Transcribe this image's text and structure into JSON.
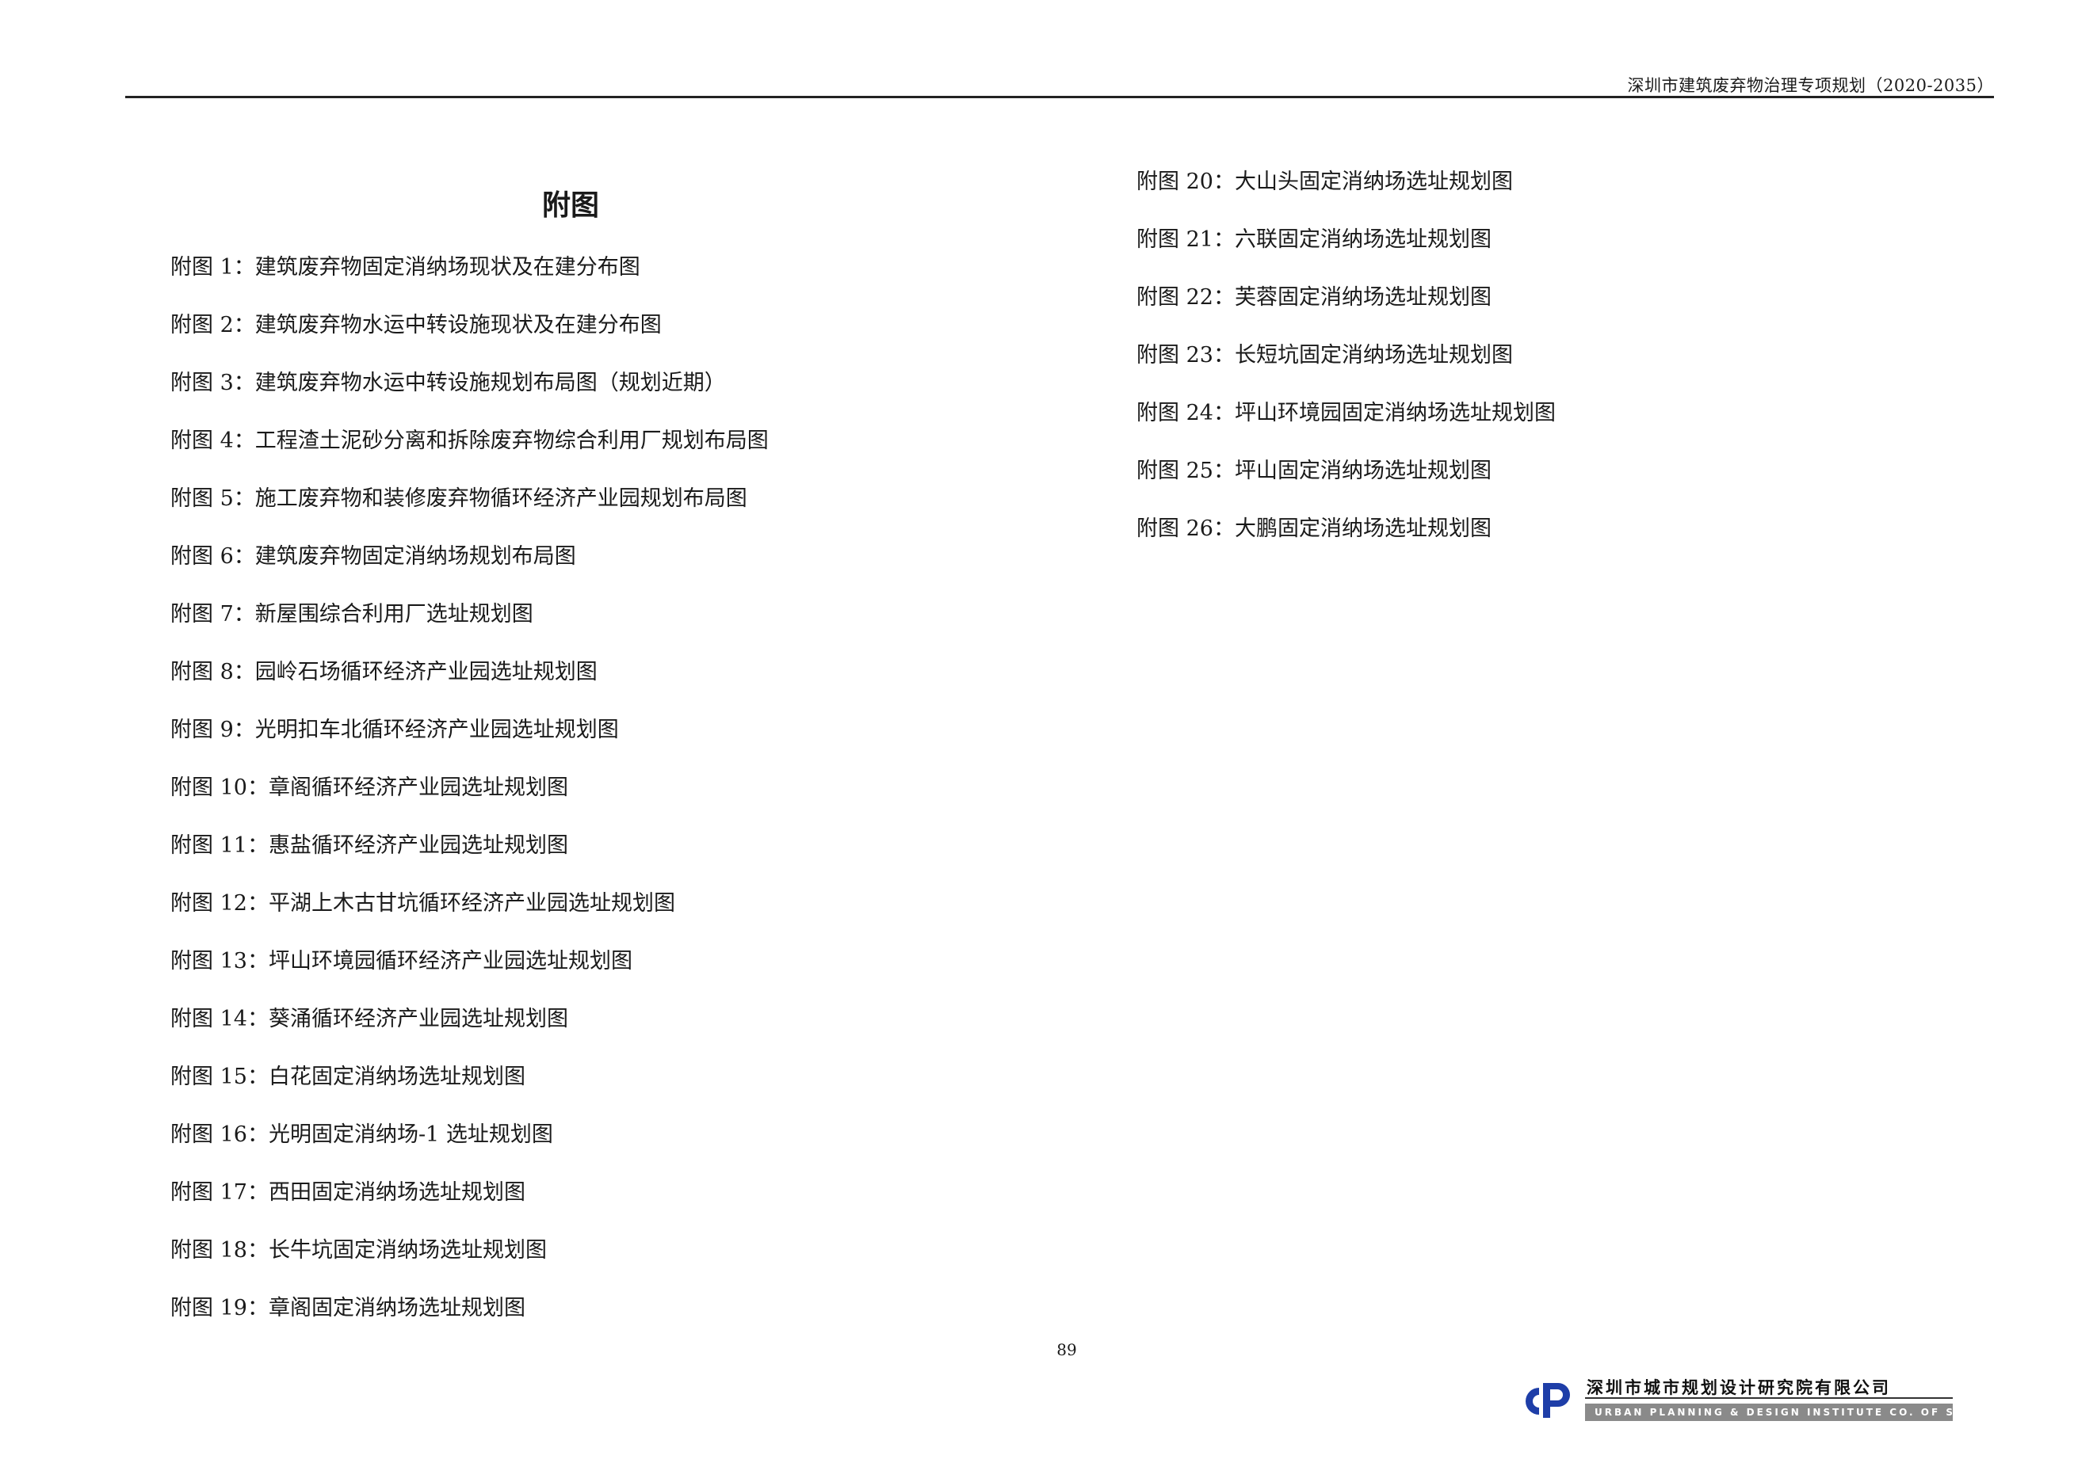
{
  "header": {
    "title": "深圳市建筑废弃物治理专项规划（2020-2035）"
  },
  "page_title": "附图",
  "left_items": [
    "附图 1：建筑废弃物固定消纳场现状及在建分布图",
    "附图 2：建筑废弃物水运中转设施现状及在建分布图",
    "附图 3：建筑废弃物水运中转设施规划布局图（规划近期）",
    "附图 4：工程渣土泥砂分离和拆除废弃物综合利用厂规划布局图",
    "附图 5：施工废弃物和装修废弃物循环经济产业园规划布局图",
    "附图 6：建筑废弃物固定消纳场规划布局图",
    "附图 7：新屋围综合利用厂选址规划图",
    "附图 8：园岭石场循环经济产业园选址规划图",
    "附图 9：光明扣车北循环经济产业园选址规划图",
    "附图 10：章阁循环经济产业园选址规划图",
    "附图 11：惠盐循环经济产业园选址规划图",
    "附图 12：平湖上木古甘坑循环经济产业园选址规划图",
    "附图 13：坪山环境园循环经济产业园选址规划图",
    "附图 14：葵涌循环经济产业园选址规划图",
    "附图 15：白花固定消纳场选址规划图",
    "附图 16：光明固定消纳场-1 选址规划图",
    "附图 17：西田固定消纳场选址规划图",
    "附图 18：长牛坑固定消纳场选址规划图",
    "附图 19：章阁固定消纳场选址规划图"
  ],
  "right_items": [
    "附图 20：大山头固定消纳场选址规划图",
    "附图 21：六联固定消纳场选址规划图",
    "附图 22：芙蓉固定消纳场选址规划图",
    "附图 23：长短坑固定消纳场选址规划图",
    "附图 24：坪山环境园固定消纳场选址规划图",
    "附图 25：坪山固定消纳场选址规划图",
    "附图 26：大鹏固定消纳场选址规划图"
  ],
  "page_number": "89",
  "footer": {
    "org_name_cn": "深圳市城市规划设计研究院有限公司",
    "org_name_en": "URBAN PLANNING & DESIGN INSTITUTE CO. OF SHENZHEN",
    "logo_icon": "udi-logo-icon",
    "logo_color": "#1e3ea8"
  }
}
